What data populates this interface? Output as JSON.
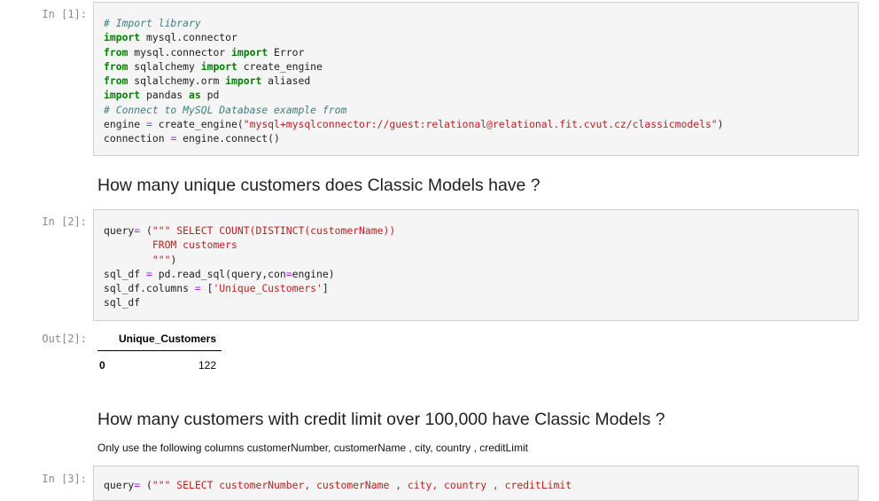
{
  "cells": [
    {
      "prompt": "In [1]:",
      "lines": [
        "# Import library",
        "import mysql.connector",
        "from mysql.connector import Error",
        "from sqlalchemy import create_engine",
        "from sqlalchemy.orm import aliased",
        "import pandas as pd",
        "# Connect to MySQL Database example from",
        "engine = create_engine(\"mysql+mysqlconnector://guest:relational@relational.fit.cvut.cz/classicmodels\")",
        "connection = engine.connect()"
      ]
    },
    {
      "heading": "How many unique customers does Classic Models have ?"
    },
    {
      "prompt": "In [2]:",
      "lines": [
        "query= (\"\"\" SELECT COUNT(DISTINCT(customerName))",
        "        FROM customers",
        "        \"\"\")",
        "sql_df = pd.read_sql(query,con=engine)",
        "sql_df.columns = ['Unique_Customers']",
        "sql_df"
      ]
    },
    {
      "out_prompt": "Out[2]:",
      "table": {
        "header": "Unique_Customers",
        "index": "0",
        "value": "122"
      }
    },
    {
      "heading": "How many customers with credit limit over 100,000 have Classic Models ?",
      "paragraph": "Only use the following columns customerNumber, customerName , city, country , creditLimit"
    },
    {
      "prompt": "In [3]:",
      "lines": [
        "query= (\"\"\" SELECT customerNumber, customerName , city, country , creditLimit"
      ]
    }
  ]
}
